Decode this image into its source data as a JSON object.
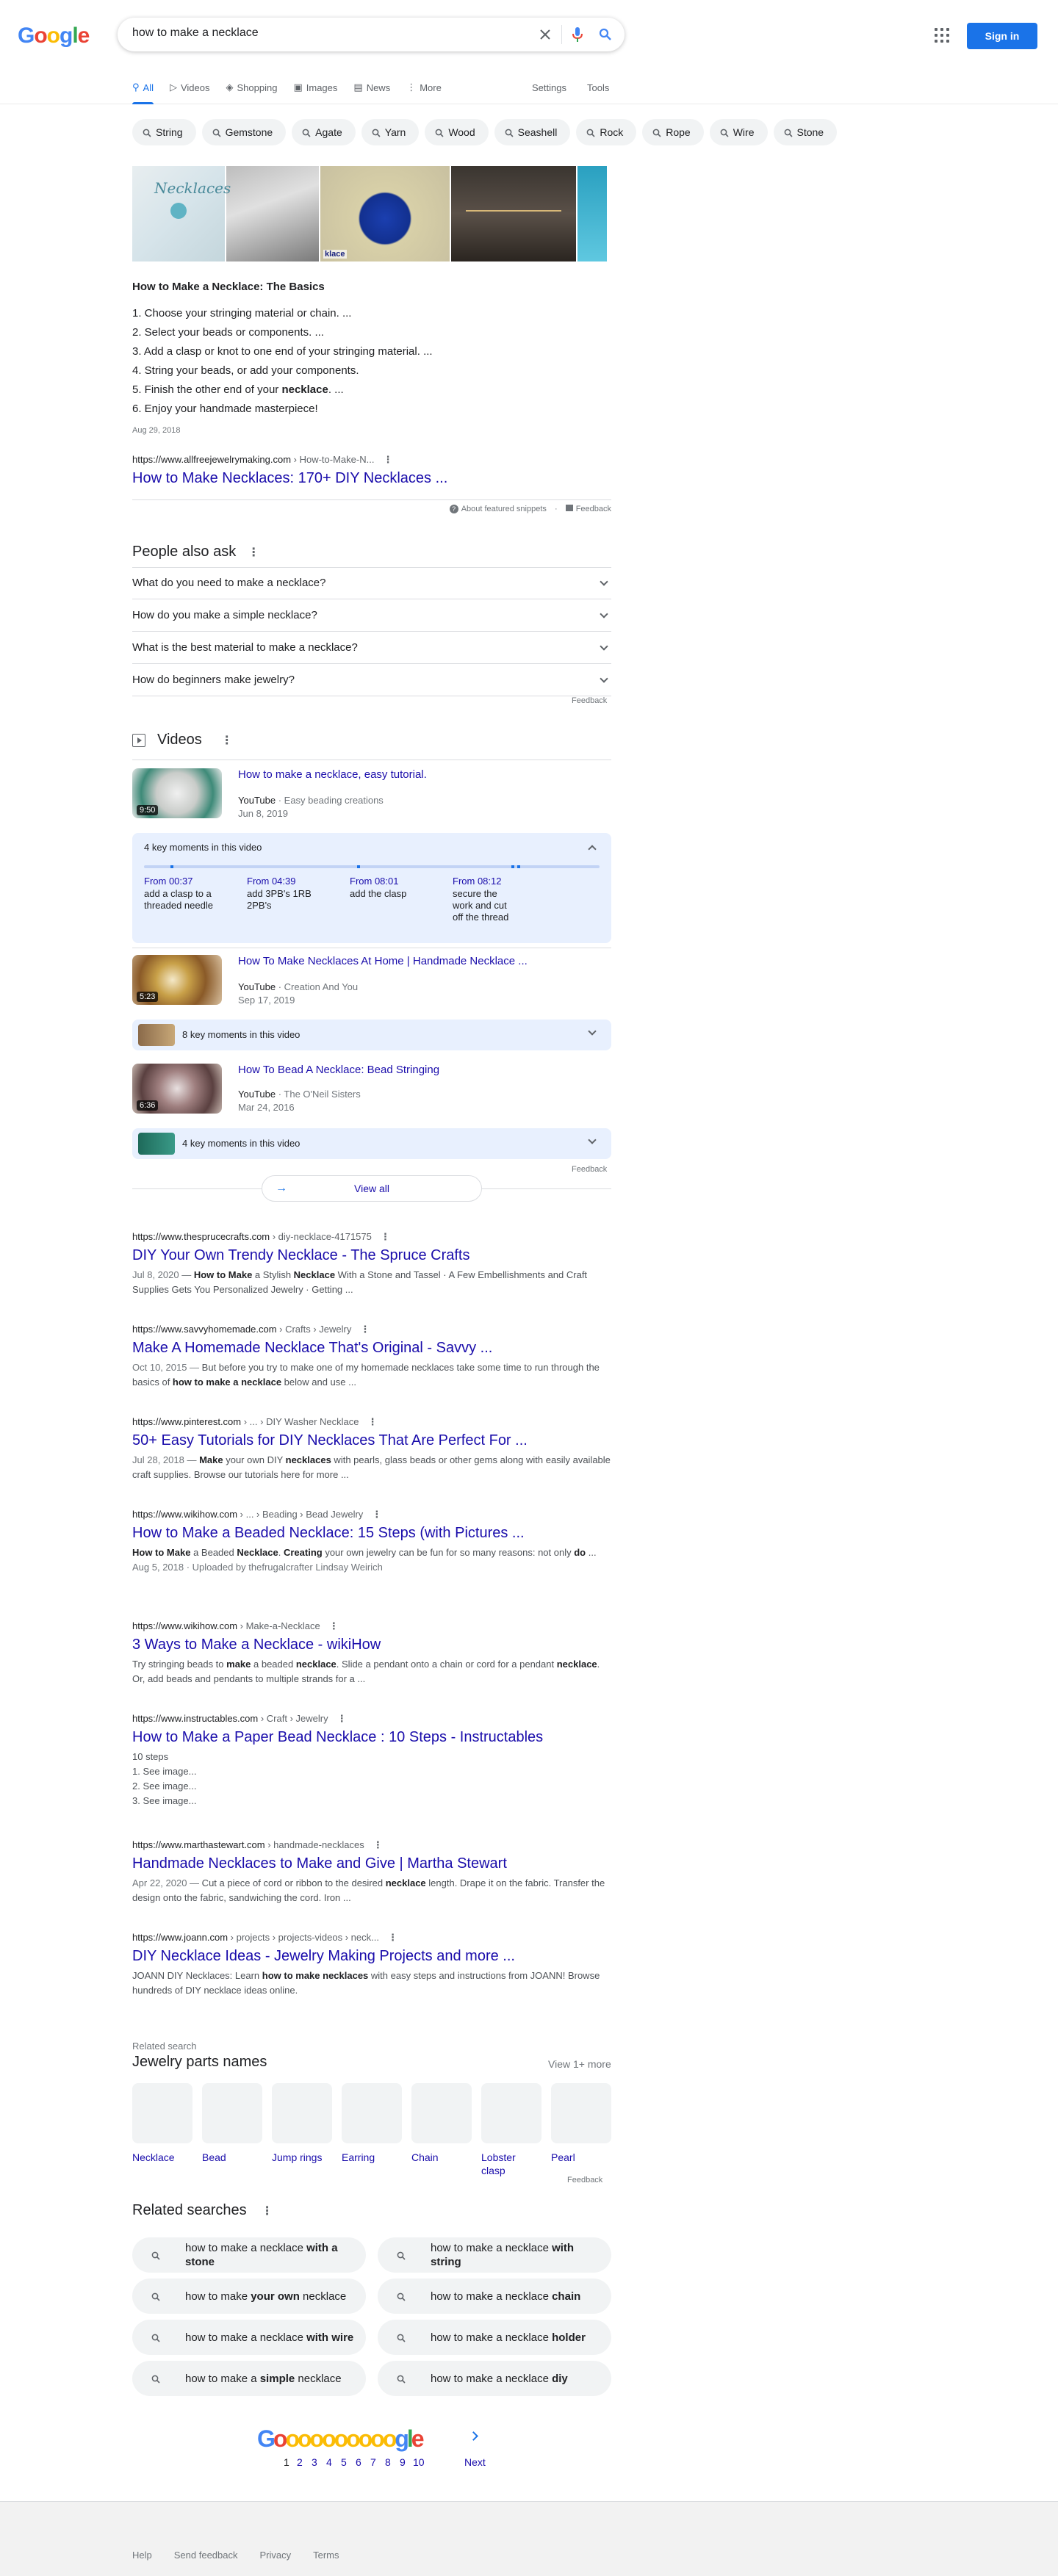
{
  "search": {
    "query": "how to make a necklace",
    "sign_in": "Sign in"
  },
  "tabs": [
    {
      "label": "All",
      "icon": "search-icon"
    },
    {
      "label": "Videos",
      "icon": "play-icon"
    },
    {
      "label": "Shopping",
      "icon": "tag-icon"
    },
    {
      "label": "Images",
      "icon": "image-icon"
    },
    {
      "label": "News",
      "icon": "news-icon"
    },
    {
      "label": "More",
      "icon": "more-vert-icon"
    }
  ],
  "tools": {
    "settings": "Settings",
    "tools": "Tools"
  },
  "chips": [
    "String",
    "Gemstone",
    "Agate",
    "Yarn",
    "Wood",
    "Seashell",
    "Rock",
    "Rope",
    "Wire",
    "Stone"
  ],
  "featured": {
    "title": "How to Make a Necklace: The Basics",
    "steps": [
      "Choose your stringing material or chain. ...",
      "Select your beads or components. ...",
      "Add a clasp or knot to one end of your stringing material. ...",
      "String your beads, or add your components.",
      "Finish the other end of your |necklace|. ...",
      "Enjoy your handmade masterpiece!"
    ],
    "date": "Aug 29, 2018",
    "cite_domain": "https://www.allfreejewelrymaking.com",
    "cite_path": " › How-to-Make-N...",
    "link": "How to Make Necklaces: 170+ DIY Necklaces ...",
    "about": "About featured snippets",
    "feedback": "Feedback",
    "image_captions": [
      "klace"
    ]
  },
  "paa": {
    "title": "People also ask",
    "questions": [
      "What do you need to make a necklace?",
      "How do you make a simple necklace?",
      "What is the best material to make a necklace?",
      "How do beginners make jewelry?"
    ],
    "feedback": "Feedback"
  },
  "videos": {
    "title": "Videos",
    "items": [
      {
        "title": "How to make a necklace, easy tutorial.",
        "source": "YouTube",
        "channel": "Easy beading creations",
        "date": "Jun 8, 2019",
        "duration": "9:50"
      },
      {
        "title": "How To Make Necklaces At Home | Handmade Necklace ...",
        "source": "YouTube",
        "channel": "Creation And You",
        "date": "Sep 17, 2019",
        "duration": "5:23"
      },
      {
        "title": "How To Bead A Necklace: Bead Stringing",
        "source": "YouTube",
        "channel": "The O'Neil Sisters",
        "date": "Mar 24, 2016",
        "duration": "6:36"
      }
    ],
    "key_moments": {
      "heading": "4 key moments in this video",
      "moments": [
        {
          "from": "From 00:37",
          "desc": "add a clasp to a threaded needle"
        },
        {
          "from": "From 04:39",
          "desc": "add 3PB's 1RB 2PB's"
        },
        {
          "from": "From 08:01",
          "desc": "add the clasp"
        },
        {
          "from": "From 08:12",
          "desc": "secure the work and cut off the thread"
        }
      ]
    },
    "km2": "8 key moments in this video",
    "km3": "4 key moments in this video",
    "feedback": "Feedback",
    "view_all": "View all"
  },
  "results": [
    {
      "domain": "https://www.thesprucecrafts.com",
      "path": " › diy-necklace-4171575",
      "title": "DIY Your Own Trendy Necklace - The Spruce Crafts",
      "desc": "Jul 8, 2020 — **How to Make** a Stylish **Necklace** With a Stone and Tassel · A Few Embellishments and Craft Supplies Gets You Personalized Jewelry · Getting ..."
    },
    {
      "domain": "https://www.savvyhomemade.com",
      "path": " › Crafts › Jewelry",
      "title": "Make A Homemade Necklace That's Original - Savvy ...",
      "desc": "Oct 10, 2015 — But before you try to make one of my homemade necklaces take some time to run through the basics of **how to make a necklace** below and use ..."
    },
    {
      "domain": "https://www.pinterest.com",
      "path": " › ... › DIY Washer Necklace",
      "title": "50+ Easy Tutorials for DIY Necklaces That Are Perfect For ...",
      "desc": "Jul 28, 2018 — **Make** your own DIY **necklaces** with pearls, glass beads or other gems along with easily available craft supplies. Browse our tutorials here for more ..."
    },
    {
      "domain": "https://www.wikihow.com",
      "path": " › ... › Beading › Bead Jewelry",
      "title": "How to Make a Beaded Necklace: 15 Steps (with Pictures ...",
      "desc": "**How to Make** a Beaded **Necklace**. **Creating** your own jewelry can be fun for so many reasons: not only **do** ...",
      "meta": "Aug 5, 2018 · Uploaded by thefrugalcrafter Lindsay Weirich"
    },
    {
      "domain": "https://www.wikihow.com",
      "path": " › Make-a-Necklace",
      "title": "3 Ways to Make a Necklace - wikiHow",
      "desc": "Try stringing beads to **make** a beaded **necklace**. Slide a pendant onto a chain or cord for a pendant **necklace**. Or, add beads and pendants to multiple strands for a ..."
    },
    {
      "domain": "https://www.instructables.com",
      "path": " › Craft › Jewelry",
      "title": "How to Make a Paper Bead Necklace : 10 Steps - Instructables",
      "desc": "10 steps",
      "steps": [
        "1. See image...",
        "2. See image...",
        "3. See image..."
      ]
    },
    {
      "domain": "https://www.marthastewart.com",
      "path": " › handmade-necklaces",
      "title": "Handmade Necklaces to Make and Give | Martha Stewart",
      "desc": "Apr 22, 2020 — Cut a piece of cord or ribbon to the desired **necklace** length. Drape it on the fabric. Transfer the design onto the fabric, sandwiching the cord. Iron ..."
    },
    {
      "domain": "https://www.joann.com",
      "path": " › projects › projects-videos › neck...",
      "title": "DIY Necklace Ideas - Jewelry Making Projects and more ...",
      "desc": "JOANN DIY Necklaces: Learn **how to make necklaces** with easy steps and instructions from JOANN! Browse hundreds of DIY necklace ideas online."
    }
  ],
  "parts": {
    "small": "Related search",
    "title": "Jewelry parts names",
    "view_more": "View 1+ more",
    "items": [
      "Necklace",
      "Bead",
      "Jump rings",
      "Earring",
      "Chain",
      "Lobster clasp",
      "Pearl"
    ],
    "feedback": "Feedback"
  },
  "related": {
    "title": "Related searches",
    "items": [
      "how to make a necklace **with a stone**",
      "how to make a necklace **with string**",
      "how to make **your own** necklace",
      "how to make a necklace **chain**",
      "how to make a necklace **with wire**",
      "how to make a necklace **holder**",
      "how to make a **simple** necklace",
      "how to make a necklace **diy**"
    ]
  },
  "pagination": {
    "pages": [
      "1",
      "2",
      "3",
      "4",
      "5",
      "6",
      "7",
      "8",
      "9",
      "10"
    ],
    "next": "Next",
    "logo_letters": [
      "G",
      "o",
      "o",
      "o",
      "o",
      "o",
      "o",
      "o",
      "o",
      "o",
      "o",
      "g",
      "l",
      "e"
    ]
  },
  "footer": [
    "Help",
    "Send feedback",
    "Privacy",
    "Terms"
  ],
  "colors": {
    "link": "#1a0dab",
    "accent": "#1a73e8",
    "blue": "#4285f4",
    "red": "#ea4335",
    "yellow": "#fbbc05",
    "green": "#34a853"
  }
}
